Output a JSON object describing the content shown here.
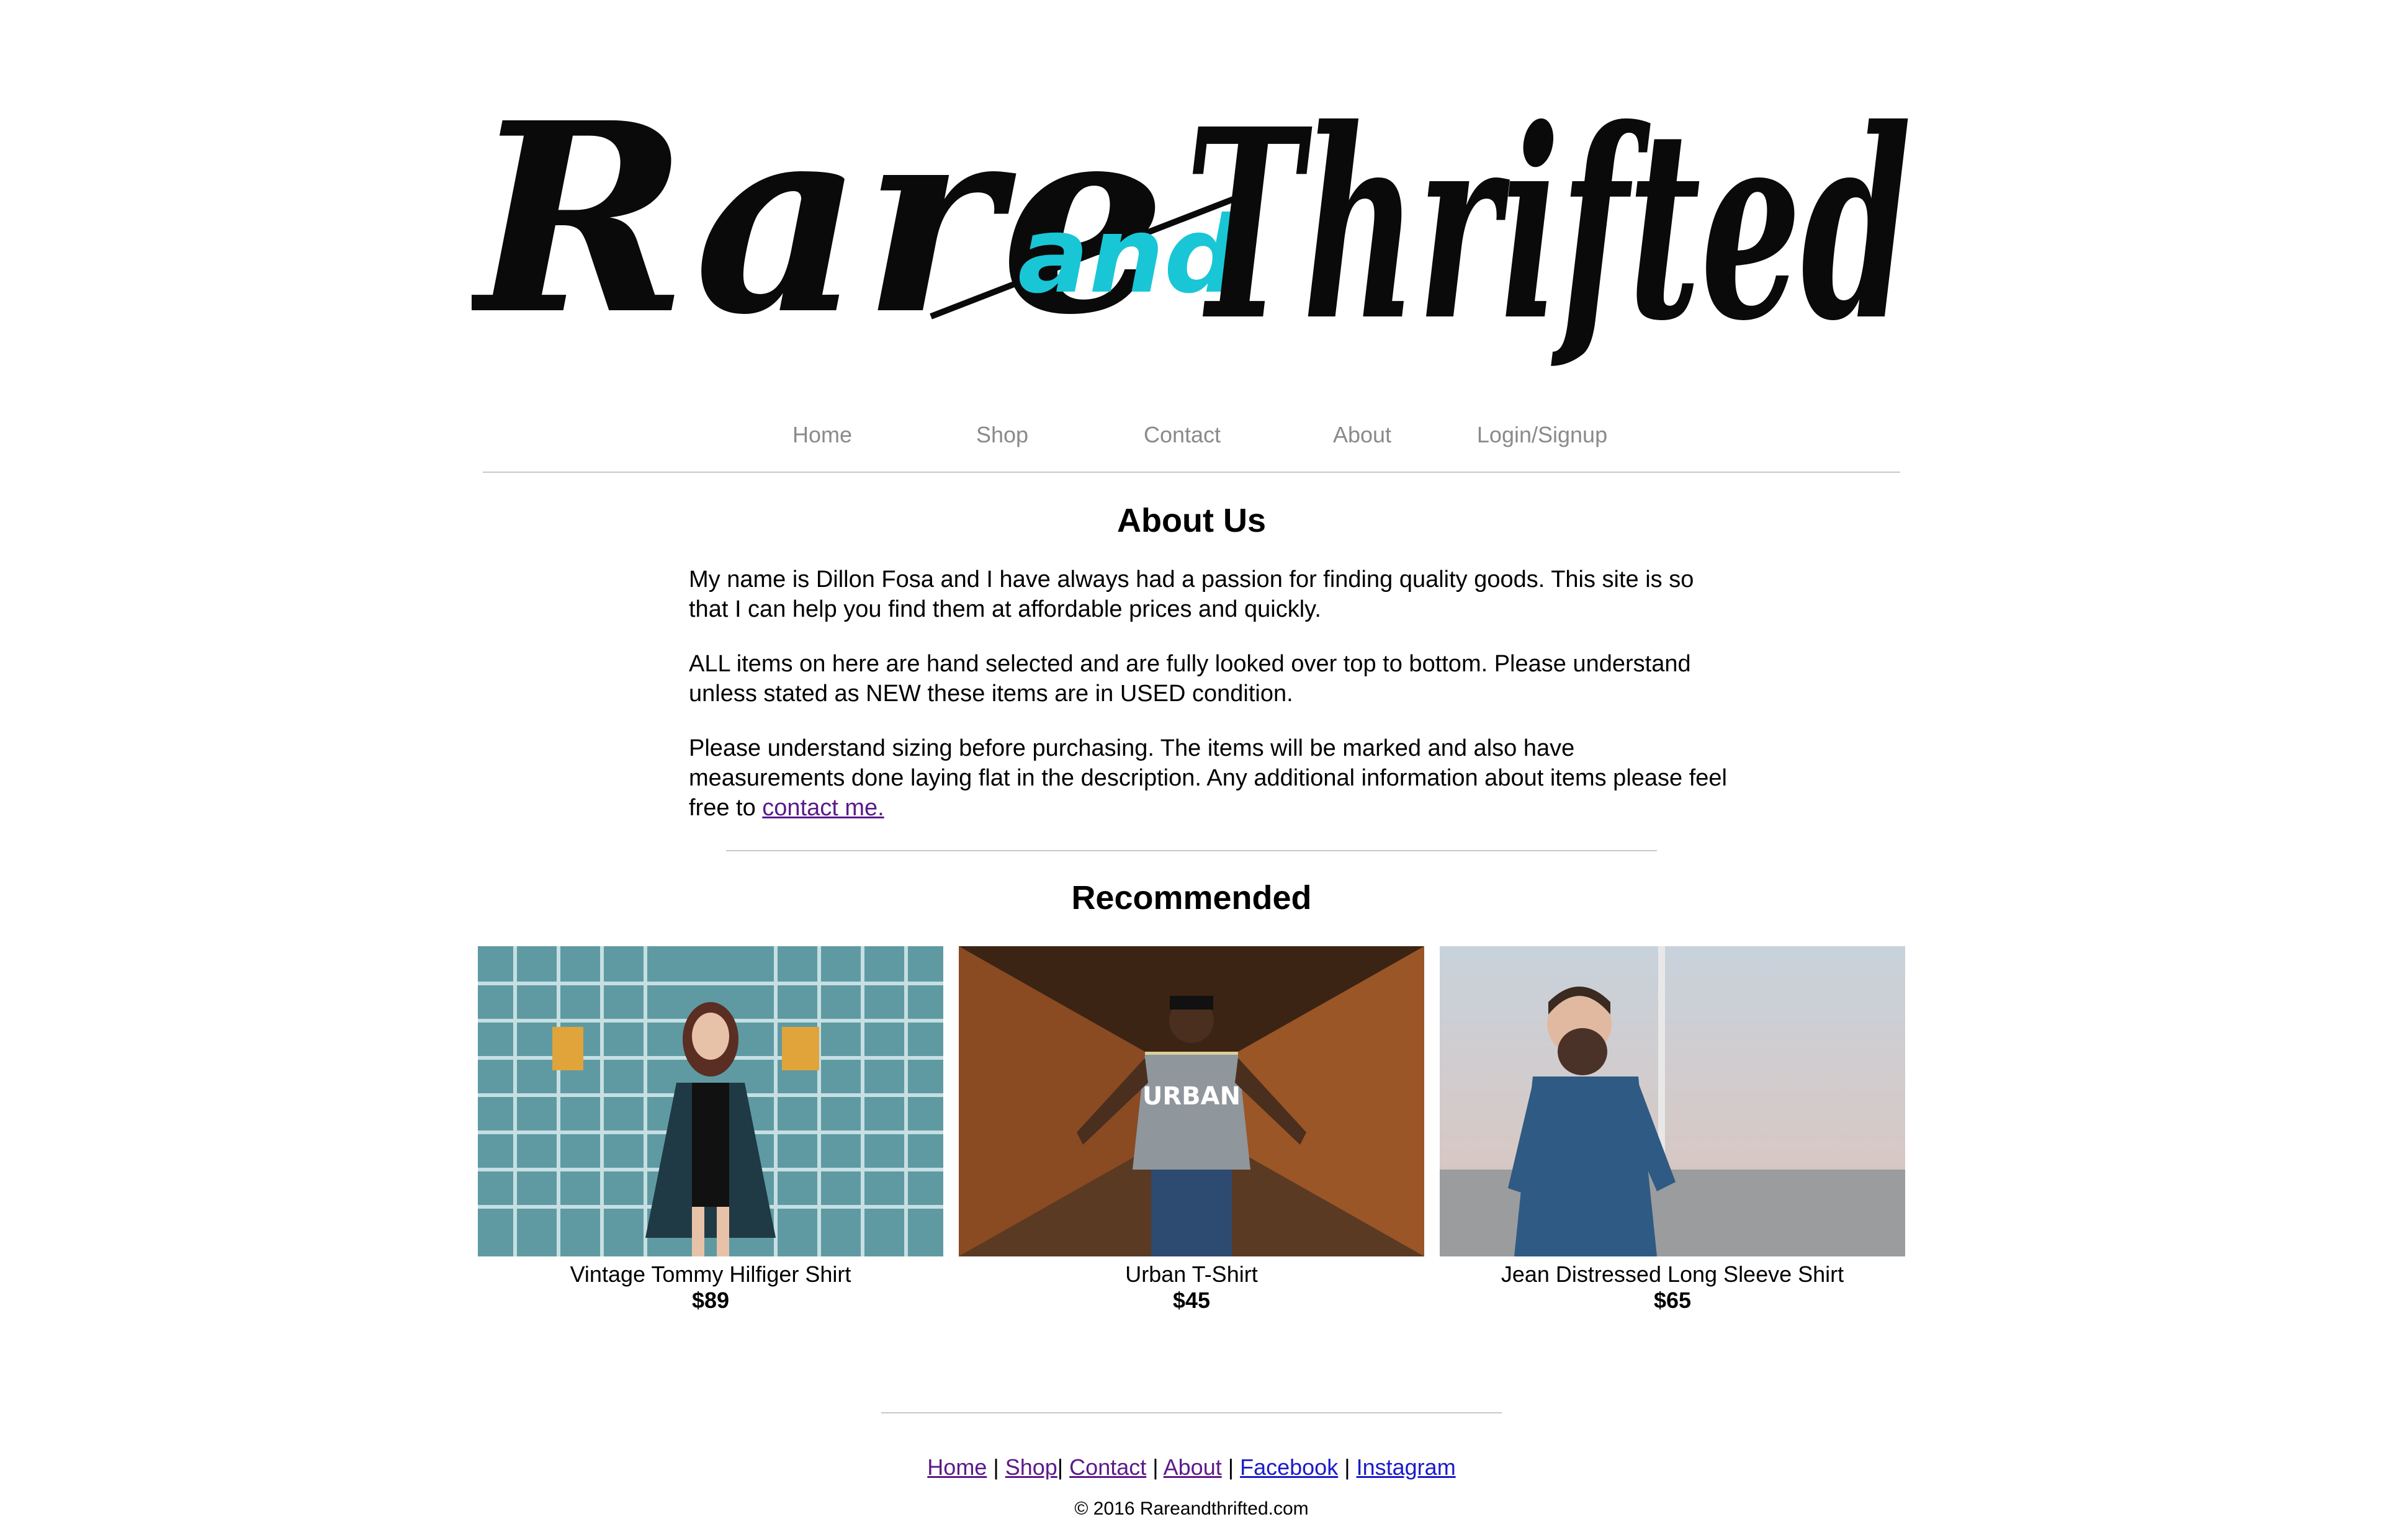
{
  "logo": {
    "word1": "Rare",
    "word2": "and",
    "word3": "Thrifted"
  },
  "nav": [
    {
      "label": "Home"
    },
    {
      "label": "Shop"
    },
    {
      "label": "Contact"
    },
    {
      "label": "About"
    },
    {
      "label": "Login/Signup"
    }
  ],
  "about": {
    "title": "About Us",
    "p1": "My name is Dillon Fosa and I have always had a passion for finding quality goods. This site is so that I can help you find them at affordable prices and quickly.",
    "p2": "ALL items on here are hand selected and are fully looked over top to bottom. Please understand unless stated as NEW these items are in USED condition.",
    "p3": "Please understand sizing before purchasing. The items will be marked and also have measurements done laying flat in the description. Any additional information about items please feel free to",
    "p3_link": "contact me."
  },
  "recommended": {
    "title": "Recommended",
    "items": [
      {
        "name": "Vintage Tommy Hilfiger Shirt",
        "price": "$89"
      },
      {
        "name": "Urban T-Shirt",
        "price": "$45"
      },
      {
        "name": "Jean Distressed Long Sleeve Shirt",
        "price": "$65"
      }
    ]
  },
  "footer": {
    "links": [
      "Home",
      "Shop",
      "Contact",
      "About",
      "Facebook",
      "Instagram"
    ],
    "separators": [
      "|",
      "|",
      "|",
      "|",
      "|"
    ],
    "copyright": "© 2016 Rareandthrifted.com"
  },
  "colors": {
    "accent": "#19c6d6",
    "link_visited": "#5b1a8a",
    "link": "#1a1acc",
    "nav_text": "#8a8a8a"
  }
}
